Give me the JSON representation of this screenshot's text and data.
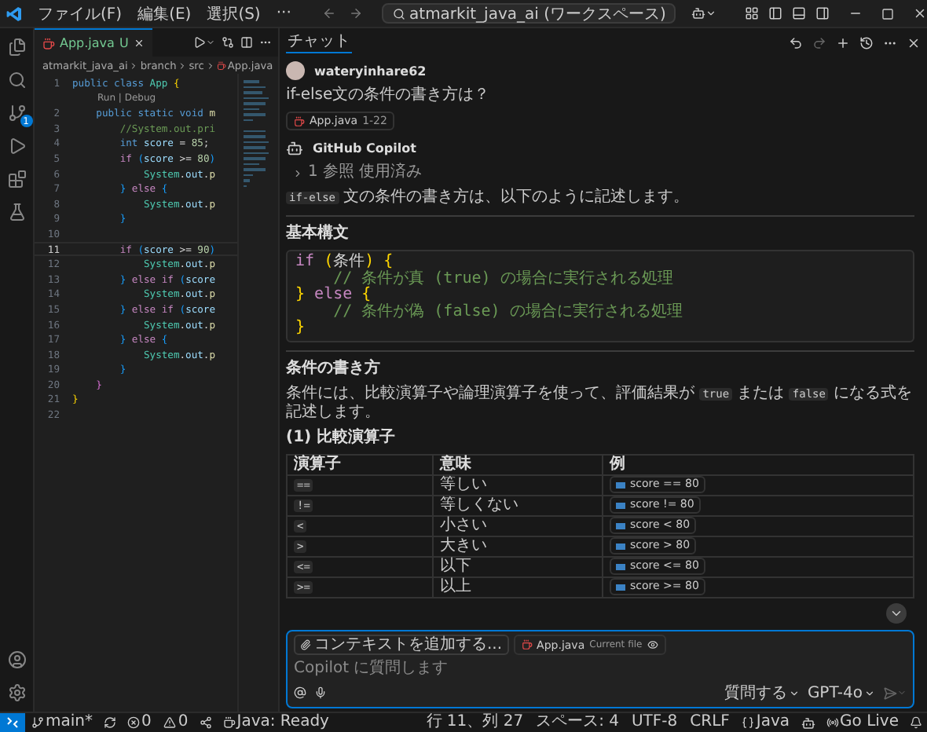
{
  "title_bar": {
    "menus": [
      "ファイル(F)",
      "編集(E)",
      "選択(S)",
      "···"
    ],
    "search": "atmarkit_java_ai (ワークスペース)"
  },
  "activity_bar": {
    "scm_badge": "1"
  },
  "editor": {
    "tab": {
      "label": "App.java",
      "status": "U",
      "selected": true
    },
    "breadcrumb": [
      "atmarkit_java_ai",
      "branch",
      "src",
      "App.java"
    ],
    "lines": [
      {
        "kind": "code",
        "number": "1",
        "current": false,
        "tokens": [
          {
            "kind": "kw",
            "text": "public"
          },
          {
            "kind": "kw",
            "text": " class"
          },
          {
            "kind": "type",
            "text": " App"
          },
          {
            "kind": "b1",
            "text": " {"
          }
        ]
      },
      {
        "kind": "lens",
        "text": "Run | Debug"
      },
      {
        "kind": "code",
        "number": "2",
        "current": false,
        "tokens": [
          {
            "kind": "kw",
            "text": "    public"
          },
          {
            "kind": "kw",
            "text": " static"
          },
          {
            "kind": "kw",
            "text": " void"
          },
          {
            "kind": "func",
            "text": " m"
          }
        ]
      },
      {
        "kind": "code",
        "number": "3",
        "current": false,
        "tokens": [
          {
            "kind": "comment",
            "text": "        //System.out.pri"
          }
        ]
      },
      {
        "kind": "code",
        "number": "4",
        "current": false,
        "tokens": [
          {
            "kind": "kw",
            "text": "        int"
          },
          {
            "kind": "var",
            "text": " score"
          },
          {
            "kind": "p",
            "text": " = "
          },
          {
            "kind": "num",
            "text": "85"
          },
          {
            "kind": "p",
            "text": ";"
          }
        ]
      },
      {
        "kind": "code",
        "number": "5",
        "current": false,
        "tokens": [
          {
            "kind": "ctl",
            "text": "        if"
          },
          {
            "kind": "b3",
            "text": " ("
          },
          {
            "kind": "var",
            "text": "score"
          },
          {
            "kind": "p",
            "text": " >= "
          },
          {
            "kind": "num",
            "text": "80"
          },
          {
            "kind": "b3",
            "text": ")"
          }
        ]
      },
      {
        "kind": "code",
        "number": "6",
        "current": false,
        "tokens": [
          {
            "kind": "type",
            "text": "            System"
          },
          {
            "kind": "p",
            "text": "."
          },
          {
            "kind": "var",
            "text": "out"
          },
          {
            "kind": "p",
            "text": "."
          },
          {
            "kind": "func",
            "text": "p"
          }
        ]
      },
      {
        "kind": "code",
        "number": "7",
        "current": false,
        "tokens": [
          {
            "kind": "b3",
            "text": "        }"
          },
          {
            "kind": "ctl",
            "text": " else"
          },
          {
            "kind": "b3",
            "text": " {"
          }
        ]
      },
      {
        "kind": "code",
        "number": "8",
        "current": false,
        "tokens": [
          {
            "kind": "type",
            "text": "            System"
          },
          {
            "kind": "p",
            "text": "."
          },
          {
            "kind": "var",
            "text": "out"
          },
          {
            "kind": "p",
            "text": "."
          },
          {
            "kind": "func",
            "text": "p"
          }
        ]
      },
      {
        "kind": "code",
        "number": "9",
        "current": false,
        "tokens": [
          {
            "kind": "b3",
            "text": "        }"
          }
        ]
      },
      {
        "kind": "code",
        "number": "10",
        "current": false
      },
      {
        "kind": "code",
        "number": "11",
        "current": true,
        "tokens": [
          {
            "kind": "ctl",
            "text": "        if"
          },
          {
            "kind": "b3",
            "text": " ("
          },
          {
            "kind": "var",
            "text": "score"
          },
          {
            "kind": "p",
            "text": " >= "
          },
          {
            "kind": "num",
            "text": "90"
          },
          {
            "kind": "b3",
            "text": ")"
          }
        ]
      },
      {
        "kind": "code",
        "number": "12",
        "current": false,
        "tokens": [
          {
            "kind": "type",
            "text": "            System"
          },
          {
            "kind": "p",
            "text": "."
          },
          {
            "kind": "var",
            "text": "out"
          },
          {
            "kind": "p",
            "text": "."
          },
          {
            "kind": "func",
            "text": "p"
          }
        ]
      },
      {
        "kind": "code",
        "number": "13",
        "current": false,
        "tokens": [
          {
            "kind": "b3",
            "text": "        }"
          },
          {
            "kind": "ctl",
            "text": " else"
          },
          {
            "kind": "ctl",
            "text": " if"
          },
          {
            "kind": "b3",
            "text": " ("
          },
          {
            "kind": "var",
            "text": "score"
          }
        ]
      },
      {
        "kind": "code",
        "number": "14",
        "current": false,
        "tokens": [
          {
            "kind": "type",
            "text": "            System"
          },
          {
            "kind": "p",
            "text": "."
          },
          {
            "kind": "var",
            "text": "out"
          },
          {
            "kind": "p",
            "text": "."
          },
          {
            "kind": "func",
            "text": "p"
          }
        ]
      },
      {
        "kind": "code",
        "number": "15",
        "current": false,
        "tokens": [
          {
            "kind": "b3",
            "text": "        }"
          },
          {
            "kind": "ctl",
            "text": " else"
          },
          {
            "kind": "ctl",
            "text": " if"
          },
          {
            "kind": "b3",
            "text": " ("
          },
          {
            "kind": "var",
            "text": "score"
          }
        ]
      },
      {
        "kind": "code",
        "number": "16",
        "current": false,
        "tokens": [
          {
            "kind": "type",
            "text": "            System"
          },
          {
            "kind": "p",
            "text": "."
          },
          {
            "kind": "var",
            "text": "out"
          },
          {
            "kind": "p",
            "text": "."
          },
          {
            "kind": "func",
            "text": "p"
          }
        ]
      },
      {
        "kind": "code",
        "number": "17",
        "current": false,
        "tokens": [
          {
            "kind": "b3",
            "text": "        }"
          },
          {
            "kind": "ctl",
            "text": " else"
          },
          {
            "kind": "b3",
            "text": " {"
          }
        ]
      },
      {
        "kind": "code",
        "number": "18",
        "current": false,
        "tokens": [
          {
            "kind": "type",
            "text": "            System"
          },
          {
            "kind": "p",
            "text": "."
          },
          {
            "kind": "var",
            "text": "out"
          },
          {
            "kind": "p",
            "text": "."
          },
          {
            "kind": "func",
            "text": "p"
          }
        ]
      },
      {
        "kind": "code",
        "number": "19",
        "current": false,
        "tokens": [
          {
            "kind": "b3",
            "text": "        }"
          }
        ]
      },
      {
        "kind": "code",
        "number": "20",
        "current": false,
        "tokens": [
          {
            "kind": "b2",
            "text": "    }"
          }
        ]
      },
      {
        "kind": "code",
        "number": "21",
        "current": false,
        "tokens": [
          {
            "kind": "b1",
            "text": "}"
          }
        ]
      },
      {
        "kind": "code",
        "number": "22",
        "current": false
      }
    ]
  },
  "chat": {
    "tab": {
      "label": "チャット",
      "selected": true
    },
    "user": {
      "name": "wateryinhare62",
      "question": "if-else文の条件の書き方は？",
      "reference": {
        "file": "App.java",
        "range": "1-22"
      }
    },
    "assistant": {
      "name": "GitHub Copilot",
      "references": {
        "label": "1 参照 使用済み",
        "expanded": false
      },
      "blocks": [
        {
          "kind": "paragraph",
          "segments": [
            {
              "kind": "code",
              "text": "if-else"
            },
            {
              "kind": "text",
              "text": " 文の条件の書き方は、以下のように記述します。"
            }
          ]
        },
        {
          "kind": "rule"
        },
        {
          "kind": "heading",
          "text": "基本構文"
        },
        {
          "kind": "codeblock",
          "lines": [
            [
              {
                "kind": "ctl",
                "text": "if"
              },
              {
                "kind": "b1",
                "text": " ("
              },
              {
                "kind": "p",
                "text": "条件"
              },
              {
                "kind": "b1",
                "text": ")"
              },
              {
                "kind": "b1",
                "text": " {"
              }
            ],
            [
              {
                "kind": "comment",
                "text": "    // 条件が真 (true) の場合に実行される処理"
              }
            ],
            [
              {
                "kind": "b1",
                "text": "}"
              },
              {
                "kind": "ctl",
                "text": " else"
              },
              {
                "kind": "b1",
                "text": " {"
              }
            ],
            [
              {
                "kind": "comment",
                "text": "    // 条件が偽 (false) の場合に実行される処理"
              }
            ],
            [
              {
                "kind": "b1",
                "text": "}"
              }
            ]
          ]
        },
        {
          "kind": "rule"
        },
        {
          "kind": "heading",
          "text": "条件の書き方"
        },
        {
          "kind": "paragraph",
          "segments": [
            {
              "kind": "text",
              "text": "条件には、比較演算子や論理演算子を使って、評価結果が "
            },
            {
              "kind": "code",
              "text": "true"
            },
            {
              "kind": "text",
              "text": " または "
            },
            {
              "kind": "code",
              "text": "false"
            },
            {
              "kind": "text",
              "text": " になる式を記述します。"
            }
          ]
        },
        {
          "kind": "heading",
          "text": "(1) 比較演算子"
        },
        {
          "kind": "table",
          "columns": [
            "演算子",
            "意味",
            "例"
          ],
          "rows": [
            [
              "==",
              "等しい",
              "score == 80"
            ],
            [
              "!=",
              "等しくない",
              "score != 80"
            ],
            [
              "<",
              "小さい",
              "score < 80"
            ],
            [
              ">",
              "大きい",
              "score > 80"
            ],
            [
              "<=",
              "以下",
              "score <= 80"
            ],
            [
              ">=",
              "以上",
              "score >= 80"
            ]
          ]
        }
      ]
    },
    "input": {
      "context_button": "コンテキストを追加する...",
      "file_chip": {
        "file": "App.java",
        "note": "Current file"
      },
      "placeholder": "Copilot に質問します",
      "mode": "質問する",
      "model": "GPT-4o"
    }
  },
  "status_bar": {
    "left": [
      {
        "kind": "branch",
        "text": "main*"
      },
      {
        "kind": "sync"
      },
      {
        "kind": "errors",
        "text": "0"
      },
      {
        "kind": "warnings",
        "text": "0"
      },
      {
        "kind": "share"
      },
      {
        "kind": "java",
        "text": "Java: Ready"
      }
    ],
    "right": [
      {
        "kind": "plain",
        "text": "行 11、列 27"
      },
      {
        "kind": "plain",
        "text": "スペース: 4"
      },
      {
        "kind": "plain",
        "text": "UTF-8"
      },
      {
        "kind": "plain",
        "text": "CRLF"
      },
      {
        "kind": "language",
        "text": "Java"
      },
      {
        "kind": "copilot"
      },
      {
        "kind": "golive",
        "text": "Go Live"
      },
      {
        "kind": "bell"
      }
    ]
  }
}
